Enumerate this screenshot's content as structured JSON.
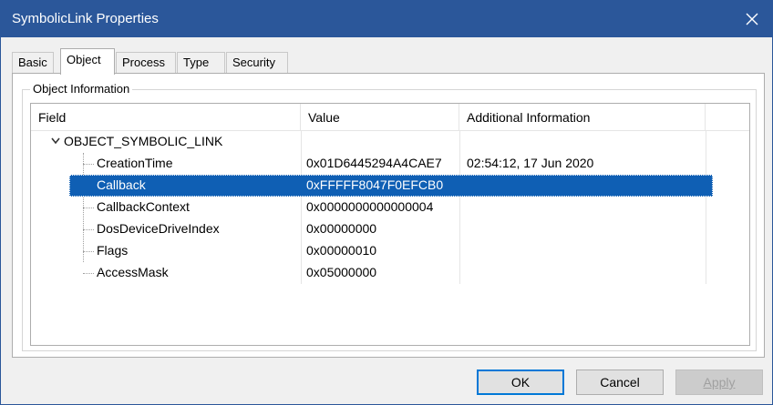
{
  "window": {
    "title": "SymbolicLink Properties"
  },
  "tabs": [
    {
      "label": "Basic"
    },
    {
      "label": "Object"
    },
    {
      "label": "Process"
    },
    {
      "label": "Type"
    },
    {
      "label": "Security"
    }
  ],
  "group": {
    "label": "Object Information"
  },
  "columns": {
    "field": "Field",
    "value": "Value",
    "info": "Additional Information"
  },
  "root": {
    "label": "OBJECT_SYMBOLIC_LINK"
  },
  "rows": [
    {
      "field": "CreationTime",
      "value": "0x01D6445294A4CAE7",
      "info": "02:54:12, 17 Jun 2020"
    },
    {
      "field": "Callback",
      "value": "0xFFFFF8047F0EFCB0",
      "info": ""
    },
    {
      "field": "CallbackContext",
      "value": "0x0000000000000004",
      "info": ""
    },
    {
      "field": "DosDeviceDriveIndex",
      "value": "0x00000000",
      "info": ""
    },
    {
      "field": "Flags",
      "value": "0x00000010",
      "info": ""
    },
    {
      "field": "AccessMask",
      "value": "0x05000000",
      "info": ""
    }
  ],
  "buttons": {
    "ok": "OK",
    "cancel": "Cancel",
    "apply": "Apply"
  },
  "colors": {
    "titlebar": "#2b579a",
    "selection": "#0f5fb4"
  }
}
